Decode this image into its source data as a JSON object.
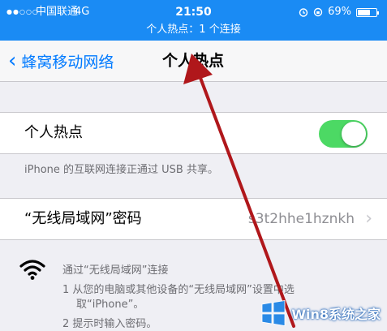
{
  "status_bar": {
    "signal": "●●○○○",
    "carrier": "中国联通",
    "network": "4G",
    "time": "21:50",
    "battery_percent": "69%",
    "battery_level": 0.69,
    "hotspot_banner": "个人热点：1 个连接"
  },
  "nav": {
    "back_label": "蜂窝移动网络",
    "title": "个人热点"
  },
  "hotspot_cell": {
    "label": "个人热点",
    "toggle_on": true
  },
  "usb_note": "iPhone 的互联网连接正通过 USB 共享。",
  "password_cell": {
    "label": "“无线局域网”密码",
    "value": "s3t2hhe1hznkh"
  },
  "instructions": {
    "line1": "通过“无线局域网”连接",
    "line2": "1 从您的电脑或其他设备的“无线局域网”设置中选",
    "line3": "取“iPhone”。",
    "line4": "2 提示时输入密码。"
  },
  "watermark": {
    "text": "Win8系统之家"
  },
  "colors": {
    "status_bar": "#1a8bf4",
    "accent": "#007aff",
    "toggle_on": "#4cd964",
    "arrow": "#b0171b"
  },
  "icons": [
    "chevron-left-icon",
    "alarm-icon",
    "lock-rotation-icon",
    "battery-icon",
    "wifi-icon",
    "chevron-right-icon",
    "windows-logo-icon"
  ]
}
